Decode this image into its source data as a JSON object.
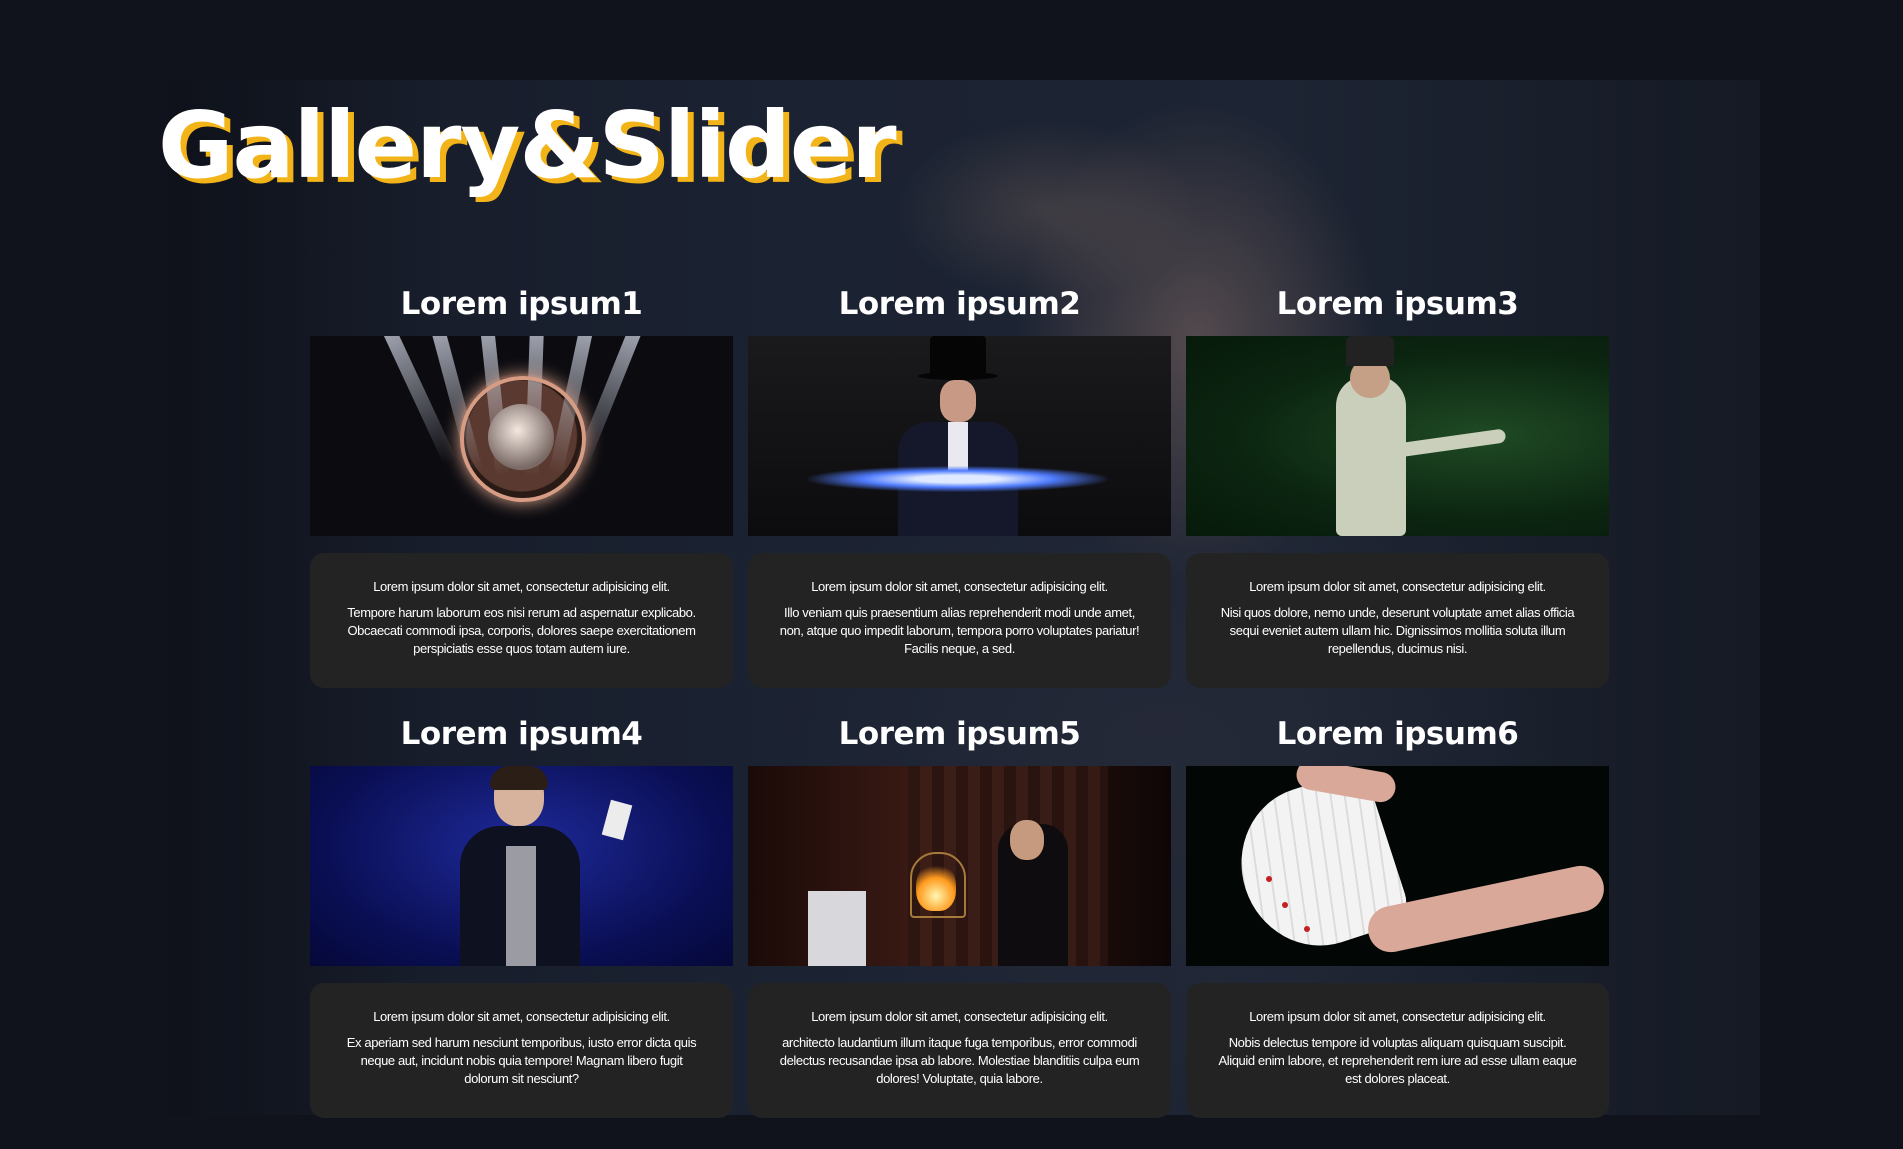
{
  "page": {
    "title": "Gallery&Slider"
  },
  "colors": {
    "background": "#10121c",
    "title_shadow": "#f2b418",
    "card_text_bg": "#232324",
    "text": "#ffffff"
  },
  "cards": [
    {
      "title": "Lorem ipsum1",
      "image": "magician-stage-globe-image",
      "lead": "Lorem ipsum dolor sit amet, consectetur adipisicing elit.",
      "body": "Tempore harum laborum eos nisi rerum ad aspernatur explicabo. Obcaecati commodi ipsa, corporis, dolores saepe exercitationem perspiciatis esse quos totam autem iure."
    },
    {
      "title": "Lorem ipsum2",
      "image": "magician-top-hat-image",
      "lead": "Lorem ipsum dolor sit amet, consectetur adipisicing elit.",
      "body": "Illo veniam quis praesentium alias reprehenderit modi unde amet, non, atque quo impedit laborum, tempora porro voluptates pariatur! Facilis neque, a sed."
    },
    {
      "title": "Lorem ipsum3",
      "image": "magician-forest-image",
      "lead": "Lorem ipsum dolor sit amet, consectetur adipisicing elit.",
      "body": "Nisi quos dolore, nemo unde, deserunt voluptate amet alias officia sequi eveniet autem ullam hic. Dignissimos mollitia soluta illum repellendus, ducimus nisi."
    },
    {
      "title": "Lorem ipsum4",
      "image": "magician-cards-stage-image",
      "lead": "Lorem ipsum dolor sit amet, consectetur adipisicing elit.",
      "body": "Ex aperiam sed harum nesciunt temporibus, iusto error dicta quis neque aut, incidunt nobis quia tempore! Magnam libero fugit dolorum sit nesciunt?"
    },
    {
      "title": "Lorem ipsum5",
      "image": "magician-fire-cage-image",
      "lead": "Lorem ipsum dolor sit amet, consectetur adipisicing elit.",
      "body": "architecto laudantium illum itaque fuga temporibus, error commodi delectus recusandae ipsa ab labore. Molestiae blanditiis culpa eum dolores! Voluptate, quia labore."
    },
    {
      "title": "Lorem ipsum6",
      "image": "card-fan-hands-image",
      "lead": "Lorem ipsum dolor sit amet, consectetur adipisicing elit.",
      "body": "Nobis delectus tempore id voluptas aliquam quisquam suscipit. Aliquid enim labore, et reprehenderit rem iure ad esse ullam eaque est dolores placeat."
    }
  ]
}
